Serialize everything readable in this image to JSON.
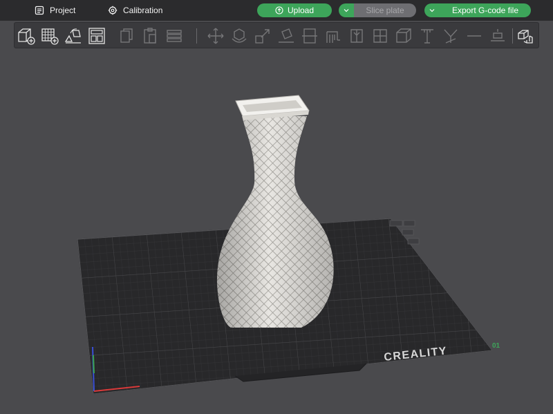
{
  "menu": {
    "project_label": "Project",
    "calibration_label": "Calibration"
  },
  "actions": {
    "upload_label": "Upload",
    "slice_label": "Slice plate",
    "export_label": "Export G-code file"
  },
  "toolbar": {
    "tools": [
      {
        "name": "add-object-icon",
        "enabled": true
      },
      {
        "name": "add-plate-icon",
        "enabled": true
      },
      {
        "name": "auto-orient-icon",
        "enabled": true
      },
      {
        "name": "arrange-icon",
        "enabled": true
      },
      {
        "name": "copy-icon",
        "enabled": false
      },
      {
        "name": "paste-icon",
        "enabled": false
      },
      {
        "name": "layers-icon",
        "enabled": false
      },
      {
        "name": "move-icon",
        "enabled": false
      },
      {
        "name": "rotate-icon",
        "enabled": false
      },
      {
        "name": "scale-icon",
        "enabled": false
      },
      {
        "name": "lay-on-face-icon",
        "enabled": false
      },
      {
        "name": "cut-icon",
        "enabled": false
      },
      {
        "name": "support-paint-icon",
        "enabled": false
      },
      {
        "name": "seam-paint-icon",
        "enabled": false
      },
      {
        "name": "color-paint-icon",
        "enabled": false
      },
      {
        "name": "hollow-icon",
        "enabled": false
      },
      {
        "name": "measure-icon",
        "enabled": false
      },
      {
        "name": "text-icon",
        "enabled": false
      },
      {
        "name": "variable-layer-icon",
        "enabled": false
      },
      {
        "name": "split-objects-icon",
        "enabled": true
      }
    ]
  },
  "viewport": {
    "bed_brand": "CREALITY",
    "plate_number": "01",
    "object_color": "#e8e6e2",
    "bed_color": "#28282a",
    "accent": "#3da55a"
  }
}
